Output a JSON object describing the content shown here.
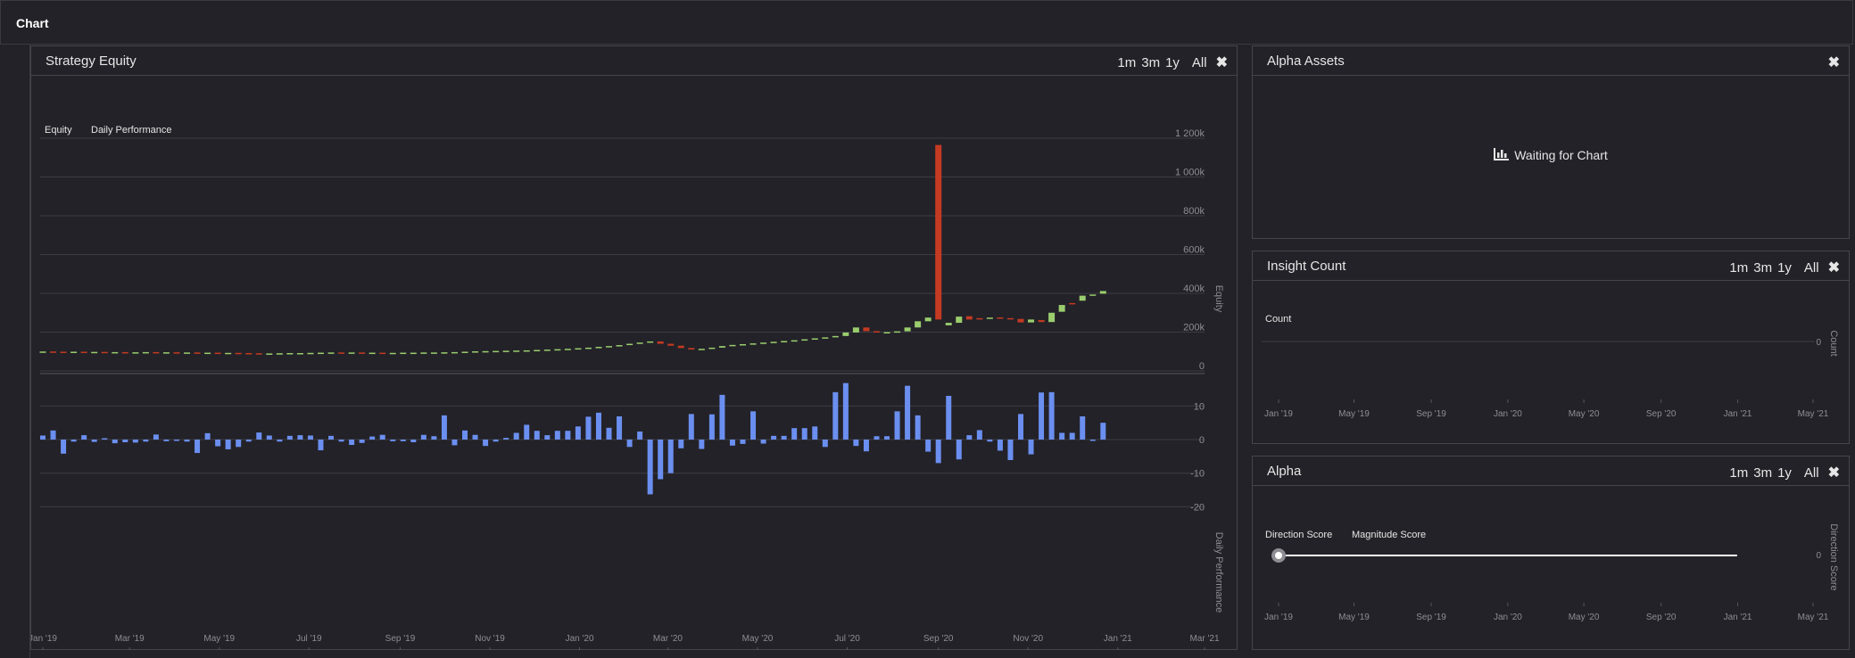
{
  "page_title": "Chart",
  "range_buttons": [
    "1m",
    "3m",
    "1y",
    "All"
  ],
  "close_glyph": "✖",
  "strategy_equity": {
    "title": "Strategy Equity",
    "legend": [
      "Equity",
      "Daily Performance"
    ],
    "equity_axis_label": "Equity",
    "performance_axis_label": "Daily Performance",
    "equity_ticks": [
      "1 200k",
      "1 000k",
      "800k",
      "600k",
      "400k",
      "200k",
      "0"
    ],
    "performance_ticks": [
      "10",
      "0",
      "-10",
      "-20"
    ],
    "x_ticks": [
      "Jan '19",
      "Mar '19",
      "May '19",
      "Jul '19",
      "Sep '19",
      "Nov '19",
      "Jan '20",
      "Mar '20",
      "May '20",
      "Jul '20",
      "Sep '20",
      "Nov '20",
      "Jan '21",
      "Mar '21"
    ]
  },
  "alpha_assets": {
    "title": "Alpha Assets",
    "waiting_icon": "bar-chart-icon",
    "waiting_text": "Waiting for Chart"
  },
  "insight_count": {
    "title": "Insight Count",
    "legend": [
      "Count"
    ],
    "axis_label": "Count",
    "y_ticks": [
      "0"
    ],
    "x_ticks": [
      "Jan '19",
      "May '19",
      "Sep '19",
      "Jan '20",
      "May '20",
      "Sep '20",
      "Jan '21",
      "May '21"
    ]
  },
  "alpha": {
    "title": "Alpha",
    "legend": [
      "Direction Score",
      "Magnitude Score"
    ],
    "axis_label": "Direction Score",
    "y_ticks": [
      "0"
    ],
    "x_ticks": [
      "Jan '19",
      "May '19",
      "Sep '19",
      "Jan '20",
      "May '20",
      "Sep '20",
      "Jan '21",
      "May '21"
    ]
  },
  "colors": {
    "background": "#232228",
    "border": "#45454b",
    "grid": "#3c3c42",
    "up_candle": "#9acd6e",
    "down_candle": "#c43a22",
    "performance_bar": "#6b8ff0",
    "line": "#ffffff"
  },
  "chart_data": [
    {
      "type": "candlestick",
      "name": "Equity",
      "x_range": [
        "2019-01-01",
        "2021-03-01"
      ],
      "ylim": [
        0,
        1200000
      ],
      "candles": [
        {
          "x": "2019-01-01",
          "open": 100000,
          "close": 100000
        },
        {
          "x": "2019-01-08",
          "open": 100000,
          "close": 99000
        },
        {
          "x": "2019-01-15",
          "open": 99000,
          "close": 98000
        },
        {
          "x": "2019-01-22",
          "open": 98000,
          "close": 99000
        },
        {
          "x": "2019-01-29",
          "open": 99000,
          "close": 97000
        },
        {
          "x": "2019-02-05",
          "open": 97000,
          "close": 98000
        },
        {
          "x": "2019-02-12",
          "open": 98000,
          "close": 97000
        },
        {
          "x": "2019-02-19",
          "open": 97000,
          "close": 97000
        },
        {
          "x": "2019-02-26",
          "open": 97000,
          "close": 96000
        },
        {
          "x": "2019-03-05",
          "open": 96000,
          "close": 96000
        },
        {
          "x": "2019-03-12",
          "open": 96000,
          "close": 97000
        },
        {
          "x": "2019-03-19",
          "open": 97000,
          "close": 96000
        },
        {
          "x": "2019-03-26",
          "open": 96000,
          "close": 96000
        },
        {
          "x": "2019-04-02",
          "open": 96000,
          "close": 95000
        },
        {
          "x": "2019-04-09",
          "open": 95000,
          "close": 95000
        },
        {
          "x": "2019-04-16",
          "open": 95000,
          "close": 94000
        },
        {
          "x": "2019-04-23",
          "open": 94000,
          "close": 94000
        },
        {
          "x": "2019-04-30",
          "open": 94000,
          "close": 93000
        },
        {
          "x": "2019-05-07",
          "open": 93000,
          "close": 93000
        },
        {
          "x": "2019-05-14",
          "open": 93000,
          "close": 92000
        },
        {
          "x": "2019-05-21",
          "open": 92000,
          "close": 91000
        },
        {
          "x": "2019-05-28",
          "open": 91000,
          "close": 90000
        },
        {
          "x": "2019-06-04",
          "open": 90000,
          "close": 90000
        },
        {
          "x": "2019-06-11",
          "open": 90000,
          "close": 91000
        },
        {
          "x": "2019-06-18",
          "open": 91000,
          "close": 92000
        },
        {
          "x": "2019-06-25",
          "open": 92000,
          "close": 92000
        },
        {
          "x": "2019-07-02",
          "open": 92000,
          "close": 93000
        },
        {
          "x": "2019-07-09",
          "open": 93000,
          "close": 94000
        },
        {
          "x": "2019-07-16",
          "open": 94000,
          "close": 95000
        },
        {
          "x": "2019-07-23",
          "open": 95000,
          "close": 94000
        },
        {
          "x": "2019-07-30",
          "open": 94000,
          "close": 95000
        },
        {
          "x": "2019-08-06",
          "open": 95000,
          "close": 94000
        },
        {
          "x": "2019-08-13",
          "open": 94000,
          "close": 94000
        },
        {
          "x": "2019-08-20",
          "open": 94000,
          "close": 93000
        },
        {
          "x": "2019-08-27",
          "open": 93000,
          "close": 93000
        },
        {
          "x": "2019-09-03",
          "open": 93000,
          "close": 94000
        },
        {
          "x": "2019-09-10",
          "open": 94000,
          "close": 94000
        },
        {
          "x": "2019-09-17",
          "open": 94000,
          "close": 95000
        },
        {
          "x": "2019-09-24",
          "open": 95000,
          "close": 95000
        },
        {
          "x": "2019-10-01",
          "open": 95000,
          "close": 96000
        },
        {
          "x": "2019-10-08",
          "open": 96000,
          "close": 97000
        },
        {
          "x": "2019-10-15",
          "open": 97000,
          "close": 99000
        },
        {
          "x": "2019-10-22",
          "open": 99000,
          "close": 101000
        },
        {
          "x": "2019-10-29",
          "open": 101000,
          "close": 102000
        },
        {
          "x": "2019-11-05",
          "open": 102000,
          "close": 103000
        },
        {
          "x": "2019-11-12",
          "open": 103000,
          "close": 104000
        },
        {
          "x": "2019-11-19",
          "open": 104000,
          "close": 105000
        },
        {
          "x": "2019-11-26",
          "open": 105000,
          "close": 106000
        },
        {
          "x": "2019-12-03",
          "open": 106000,
          "close": 108000
        },
        {
          "x": "2019-12-10",
          "open": 108000,
          "close": 110000
        },
        {
          "x": "2019-12-17",
          "open": 110000,
          "close": 112000
        },
        {
          "x": "2019-12-24",
          "open": 112000,
          "close": 114000
        },
        {
          "x": "2019-12-31",
          "open": 114000,
          "close": 117000
        },
        {
          "x": "2020-01-07",
          "open": 117000,
          "close": 120000
        },
        {
          "x": "2020-01-14",
          "open": 120000,
          "close": 124000
        },
        {
          "x": "2020-01-21",
          "open": 124000,
          "close": 128000
        },
        {
          "x": "2020-01-28",
          "open": 128000,
          "close": 133000
        },
        {
          "x": "2020-02-04",
          "open": 133000,
          "close": 140000
        },
        {
          "x": "2020-02-11",
          "open": 140000,
          "close": 146000
        },
        {
          "x": "2020-02-18",
          "open": 146000,
          "close": 152000
        },
        {
          "x": "2020-02-25",
          "open": 152000,
          "close": 140000
        },
        {
          "x": "2020-03-03",
          "open": 140000,
          "close": 130000
        },
        {
          "x": "2020-03-10",
          "open": 130000,
          "close": 118000
        },
        {
          "x": "2020-03-17",
          "open": 118000,
          "close": 110000
        },
        {
          "x": "2020-03-24",
          "open": 110000,
          "close": 114000
        },
        {
          "x": "2020-03-31",
          "open": 114000,
          "close": 120000
        },
        {
          "x": "2020-04-07",
          "open": 120000,
          "close": 128000
        },
        {
          "x": "2020-04-14",
          "open": 128000,
          "close": 134000
        },
        {
          "x": "2020-04-21",
          "open": 134000,
          "close": 138000
        },
        {
          "x": "2020-04-28",
          "open": 138000,
          "close": 142000
        },
        {
          "x": "2020-05-05",
          "open": 142000,
          "close": 146000
        },
        {
          "x": "2020-05-12",
          "open": 146000,
          "close": 150000
        },
        {
          "x": "2020-05-19",
          "open": 150000,
          "close": 154000
        },
        {
          "x": "2020-05-26",
          "open": 154000,
          "close": 158000
        },
        {
          "x": "2020-06-02",
          "open": 158000,
          "close": 163000
        },
        {
          "x": "2020-06-09",
          "open": 163000,
          "close": 168000
        },
        {
          "x": "2020-06-16",
          "open": 168000,
          "close": 173000
        },
        {
          "x": "2020-06-23",
          "open": 173000,
          "close": 180000
        },
        {
          "x": "2020-06-30",
          "open": 180000,
          "close": 198000
        },
        {
          "x": "2020-07-07",
          "open": 198000,
          "close": 224000
        },
        {
          "x": "2020-07-14",
          "open": 224000,
          "close": 205000
        },
        {
          "x": "2020-07-21",
          "open": 205000,
          "close": 198000
        },
        {
          "x": "2020-07-28",
          "open": 198000,
          "close": 200000
        },
        {
          "x": "2020-08-04",
          "open": 200000,
          "close": 204000
        },
        {
          "x": "2020-08-11",
          "open": 204000,
          "close": 224000
        },
        {
          "x": "2020-08-18",
          "open": 224000,
          "close": 256000
        },
        {
          "x": "2020-08-25",
          "open": 256000,
          "close": 275000
        },
        {
          "x": "2020-09-01",
          "open": 1165000,
          "close": 265000
        },
        {
          "x": "2020-09-08",
          "open": 235000,
          "close": 248000
        },
        {
          "x": "2020-09-15",
          "open": 248000,
          "close": 280000
        },
        {
          "x": "2020-09-22",
          "open": 282000,
          "close": 265000
        },
        {
          "x": "2020-09-29",
          "open": 272000,
          "close": 268000
        },
        {
          "x": "2020-10-06",
          "open": 270000,
          "close": 275000
        },
        {
          "x": "2020-10-13",
          "open": 276000,
          "close": 272000
        },
        {
          "x": "2020-10-20",
          "open": 272000,
          "close": 268000
        },
        {
          "x": "2020-10-27",
          "open": 268000,
          "close": 250000
        },
        {
          "x": "2020-11-03",
          "open": 250000,
          "close": 265000
        },
        {
          "x": "2020-11-10",
          "open": 262000,
          "close": 252000
        },
        {
          "x": "2020-11-17",
          "open": 252000,
          "close": 300000
        },
        {
          "x": "2020-11-24",
          "open": 305000,
          "close": 340000
        },
        {
          "x": "2020-12-01",
          "open": 350000,
          "close": 345000
        },
        {
          "x": "2020-12-08",
          "open": 362000,
          "close": 388000
        },
        {
          "x": "2020-12-15",
          "open": 388000,
          "close": 394000
        },
        {
          "x": "2020-12-22",
          "open": 398000,
          "close": 412000
        }
      ]
    },
    {
      "type": "bar",
      "name": "Daily Performance",
      "ylim": [
        -20,
        15
      ],
      "x": [
        "2019-01-01",
        "2019-01-08",
        "2019-01-15",
        "2019-01-22",
        "2019-01-29",
        "2019-02-05",
        "2019-02-12",
        "2019-02-19",
        "2019-02-26",
        "2019-03-05",
        "2019-03-12",
        "2019-03-19",
        "2019-03-26",
        "2019-04-02",
        "2019-04-09",
        "2019-04-16",
        "2019-04-23",
        "2019-04-30",
        "2019-05-07",
        "2019-05-14",
        "2019-05-21",
        "2019-05-28",
        "2019-06-04",
        "2019-06-11",
        "2019-06-18",
        "2019-06-25",
        "2019-07-02",
        "2019-07-09",
        "2019-07-16",
        "2019-07-23",
        "2019-07-30",
        "2019-08-06",
        "2019-08-13",
        "2019-08-20",
        "2019-08-27",
        "2019-09-03",
        "2019-09-10",
        "2019-09-17",
        "2019-09-24",
        "2019-10-01",
        "2019-10-08",
        "2019-10-15",
        "2019-10-22",
        "2019-10-29",
        "2019-11-05",
        "2019-11-12",
        "2019-11-19",
        "2019-11-26",
        "2019-12-03",
        "2019-12-10",
        "2019-12-17",
        "2019-12-24",
        "2019-12-31",
        "2020-01-07",
        "2020-01-14",
        "2020-01-21",
        "2020-01-28",
        "2020-02-04",
        "2020-02-11",
        "2020-02-18",
        "2020-02-25",
        "2020-03-03",
        "2020-03-10",
        "2020-03-17",
        "2020-03-24",
        "2020-03-31",
        "2020-04-07",
        "2020-04-14",
        "2020-04-21",
        "2020-04-28",
        "2020-05-05",
        "2020-05-12",
        "2020-05-19",
        "2020-05-26",
        "2020-06-02",
        "2020-06-09",
        "2020-06-16",
        "2020-06-23",
        "2020-06-30",
        "2020-07-07",
        "2020-07-14",
        "2020-07-21",
        "2020-07-28",
        "2020-08-04",
        "2020-08-11",
        "2020-08-18",
        "2020-08-25",
        "2020-09-01",
        "2020-09-08",
        "2020-09-15",
        "2020-09-22",
        "2020-09-29",
        "2020-10-06",
        "2020-10-13",
        "2020-10-20",
        "2020-10-27",
        "2020-11-03",
        "2020-11-10",
        "2020-11-17",
        "2020-11-24",
        "2020-12-01",
        "2020-12-08",
        "2020-12-15",
        "2020-12-22"
      ],
      "values": [
        1.2,
        2.7,
        -4.2,
        -0.6,
        1.3,
        -0.7,
        0.4,
        -1.1,
        -0.8,
        -0.9,
        -0.6,
        1.5,
        -0.5,
        -0.4,
        -0.6,
        -4.0,
        1.9,
        -2.0,
        -2.9,
        -2.2,
        -0.6,
        2.1,
        1.2,
        -0.6,
        1.1,
        1.3,
        1.2,
        -3.2,
        1.1,
        -0.6,
        -1.6,
        -1.0,
        0.9,
        1.4,
        -0.5,
        -0.5,
        -0.8,
        1.4,
        1.0,
        7.2,
        -1.7,
        2.7,
        1.4,
        -1.9,
        -0.6,
        0.5,
        2.0,
        4.4,
        2.6,
        1.3,
        2.6,
        2.6,
        3.9,
        6.8,
        8.0,
        3.5,
        6.9,
        -2.2,
        2.4,
        -16.3,
        -11.8,
        -10.0,
        -2.6,
        7.6,
        -2.8,
        7.5,
        13.3,
        -1.8,
        -1.3,
        8.4,
        -1.2,
        1.1,
        1.1,
        3.4,
        3.4,
        3.9,
        -2.2,
        14.1,
        16.8,
        -1.9,
        -3.5,
        1.0,
        1.0,
        8.4,
        16.0,
        7.2,
        -3.6,
        -7.0,
        13.0,
        -5.9,
        1.3,
        2.8,
        -0.6,
        -3.3,
        -6.1,
        7.6,
        -4.4,
        14.0,
        14.1,
        2.0,
        2.0,
        6.9,
        -0.4,
        5.0
      ]
    },
    {
      "type": "line",
      "name": "Count",
      "x_range": [
        "2019-01-01",
        "2021-05-01"
      ],
      "values": [
        0
      ],
      "y_ticks": [
        "0"
      ]
    },
    {
      "type": "line",
      "name": "Direction Score",
      "x": [
        "2019-01-01",
        "2020-12-31"
      ],
      "values": [
        0,
        0
      ]
    }
  ]
}
